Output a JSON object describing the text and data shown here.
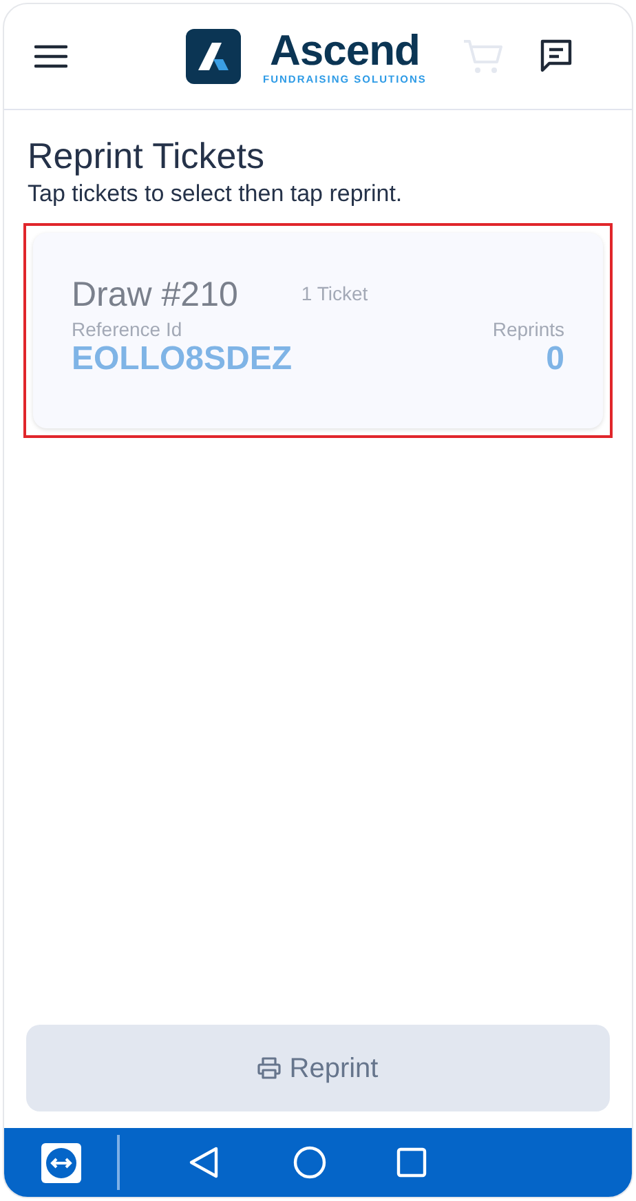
{
  "header": {
    "brand": "Ascend",
    "tagline": "FUNDRAISING SOLUTIONS"
  },
  "page": {
    "title": "Reprint Tickets",
    "subtitle": "Tap tickets to select then tap reprint."
  },
  "tickets": [
    {
      "draw": "Draw #210",
      "count": "1 Ticket",
      "reference_label": "Reference Id",
      "reference": "EOLLO8SDEZ",
      "reprints_label": "Reprints",
      "reprints": "0",
      "selected": true
    }
  ],
  "reprint_button": {
    "label": "Reprint",
    "disabled": true
  }
}
